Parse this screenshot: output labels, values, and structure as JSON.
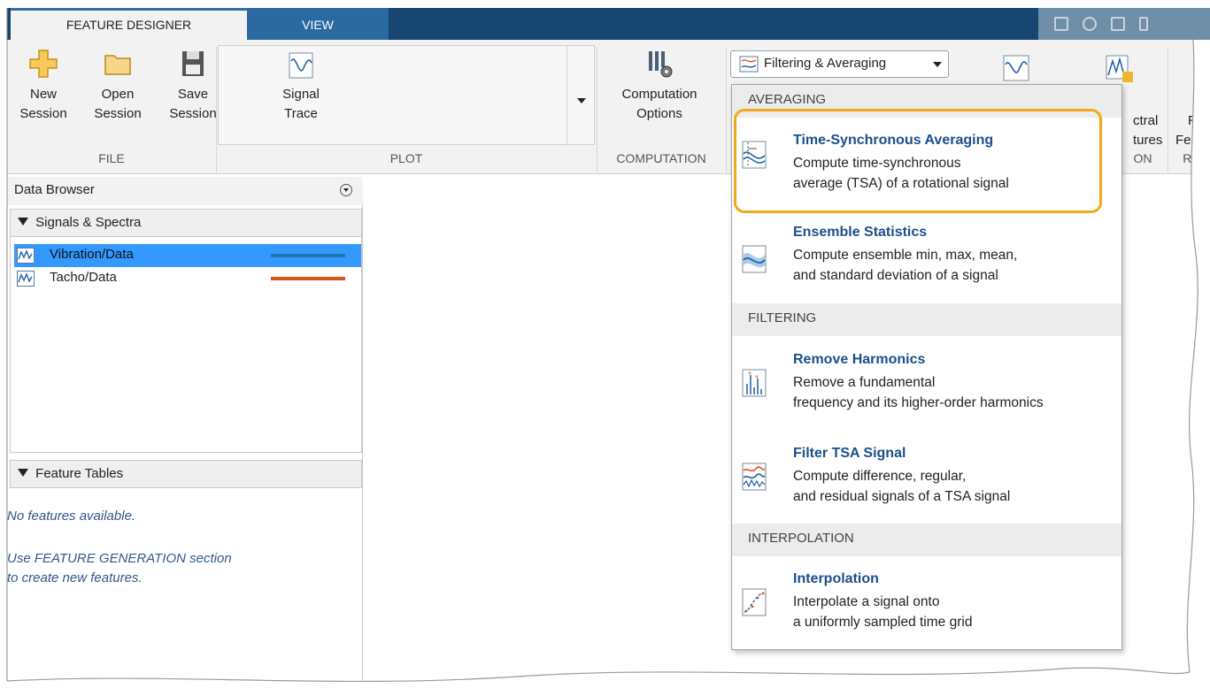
{
  "tabs": {
    "feature_designer": "FEATURE DESIGNER",
    "view": "VIEW"
  },
  "ribbon": {
    "file": {
      "new_line1": "New",
      "new_line2": "Session",
      "open_line1": "Open",
      "open_line2": "Session",
      "save_line1": "Save",
      "save_line2": "Session",
      "group": "FILE"
    },
    "plot": {
      "signal_trace_line1": "Signal",
      "signal_trace_line2": "Trace",
      "group": "PLOT"
    },
    "computation": {
      "options_line1": "Computation",
      "options_line2": "Options",
      "group": "COMPUTATION"
    },
    "filtering_button": "Filtering & Averaging",
    "clipped": {
      "spectral_line1": "ctral",
      "spectral_line2": "tures",
      "group_on": "ON",
      "rank_line1": "R",
      "rank_line2": "Feat",
      "group_ran": "RAN"
    }
  },
  "browser": {
    "title": "Data Browser",
    "signals_section": "Signals & Spectra",
    "signals": [
      {
        "name": "Vibration/Data",
        "color": "#1f77b4"
      },
      {
        "name": "Tacho/Data",
        "color": "#d95319"
      }
    ],
    "feature_section": "Feature Tables",
    "no_features": "No features available.",
    "hint_line1": "Use FEATURE GENERATION section",
    "hint_line2": "to create new features."
  },
  "menu": {
    "averaging_header": "AVERAGING",
    "tsa": {
      "title": "Time-Synchronous Averaging",
      "desc1": "Compute time-synchronous",
      "desc2": "average (TSA) of a rotational signal"
    },
    "ensemble": {
      "title": "Ensemble Statistics",
      "desc1": "Compute ensemble min, max, mean,",
      "desc2": "and standard deviation of a signal"
    },
    "filtering_header": "FILTERING",
    "harmonics": {
      "title": "Remove Harmonics",
      "desc1": "Remove a fundamental",
      "desc2": "frequency and its higher-order harmonics"
    },
    "filter_tsa": {
      "title": "Filter TSA Signal",
      "desc1": "Compute difference, regular,",
      "desc2": "and residual signals of a TSA signal"
    },
    "interpolation_header": "INTERPOLATION",
    "interp": {
      "title": "Interpolation",
      "desc1": "Interpolate a signal onto",
      "desc2": "a uniformly sampled time grid"
    }
  },
  "colors": {
    "tab_bar": "#16456f",
    "selection": "#3399ff",
    "highlight": "#f0a91a",
    "menu_title": "#1b4f8c"
  }
}
